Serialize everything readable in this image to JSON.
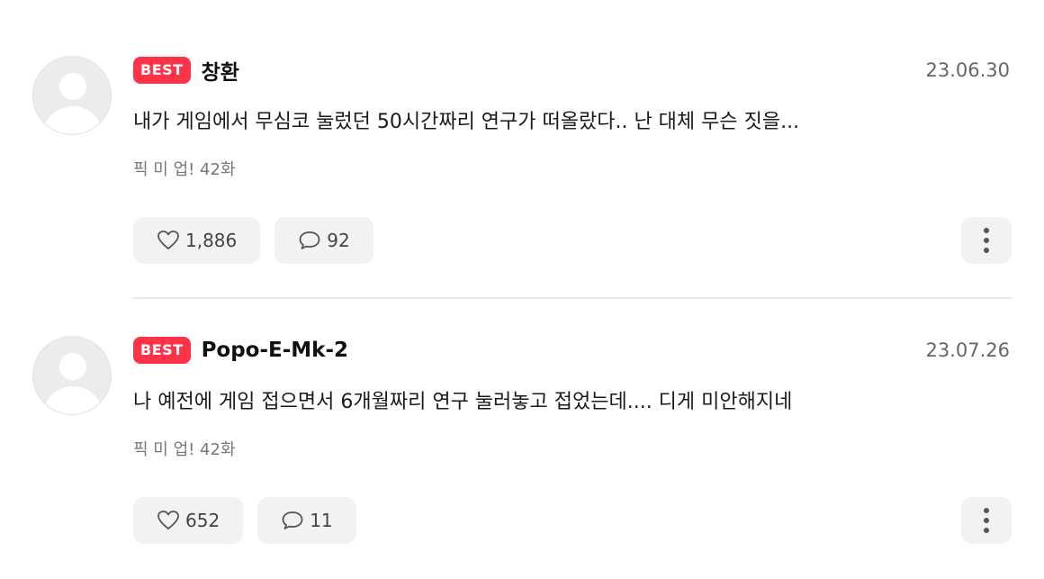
{
  "comments": [
    {
      "badge": "BEST",
      "author": "창환",
      "date": "23.06.30",
      "text": "내가 게임에서 무심코 눌렀던 50시간짜리 연구가 떠올랐다.. 난 대체 무슨 짓을...",
      "episode": "픽 미 업! 42화",
      "likes": "1,886",
      "replies": "92",
      "like_icon": "heart-icon",
      "reply_icon": "speech-bubble-icon",
      "more_icon": "vertical-ellipsis-icon"
    },
    {
      "badge": "BEST",
      "author": "Popo-E-Mk-2",
      "date": "23.07.26",
      "text": "나 예전에 게임 접으면서 6개월짜리 연구 눌러놓고 접었는데.... 디게 미안해지네",
      "episode": "픽 미 업! 42화",
      "likes": "652",
      "replies": "11",
      "like_icon": "heart-icon",
      "reply_icon": "speech-bubble-icon",
      "more_icon": "vertical-ellipsis-icon"
    }
  ],
  "colors": {
    "badge_bg": "#ff3348",
    "button_bg": "#f2f2f2",
    "divider": "#e8e8e8"
  }
}
